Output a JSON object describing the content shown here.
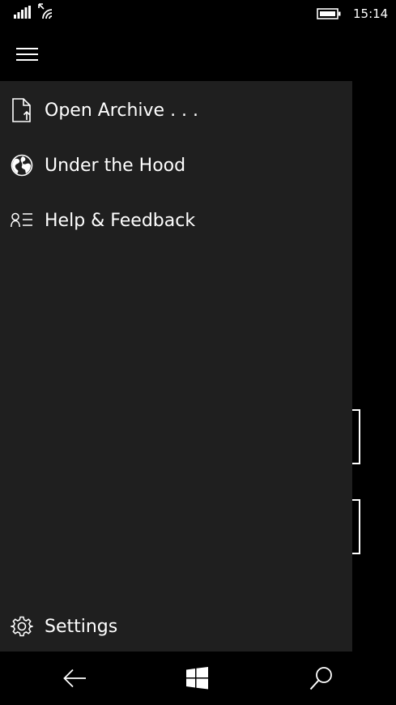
{
  "status_bar": {
    "time": "15:14",
    "icons": [
      "signal-icon",
      "wifi-icon",
      "battery-icon"
    ]
  },
  "header": {
    "menu_icon": "hamburger-icon"
  },
  "nav_pane": {
    "items": [
      {
        "label": "Open Archive . . .",
        "icon": "open-file-icon"
      },
      {
        "label": "Under the Hood",
        "icon": "globe-icon"
      },
      {
        "label": "Help & Feedback",
        "icon": "help-feedback-icon"
      }
    ],
    "footer": {
      "label": "Settings",
      "icon": "gear-icon"
    }
  },
  "system_nav": {
    "buttons": [
      "back-arrow-icon",
      "windows-logo-icon",
      "search-icon"
    ]
  },
  "colors": {
    "background": "#000000",
    "pane": "#1f1f1f",
    "foreground": "#ffffff"
  }
}
